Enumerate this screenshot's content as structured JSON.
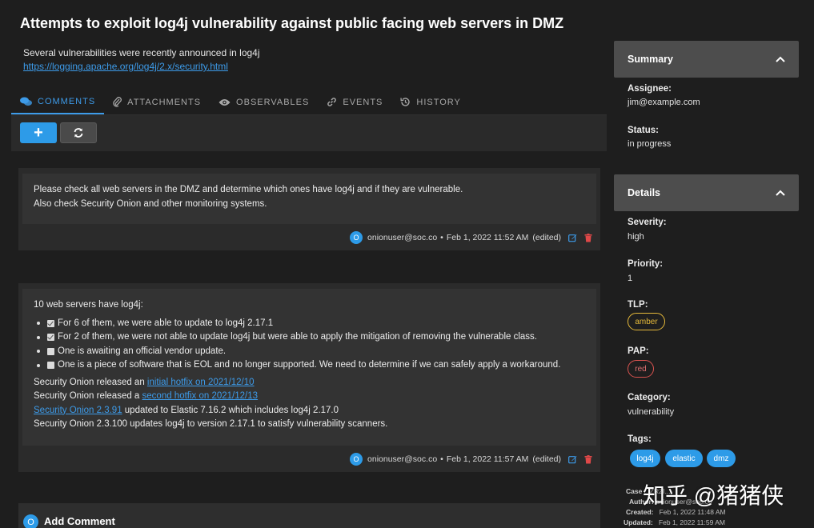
{
  "case": {
    "title": "Attempts to exploit log4j vulnerability against public facing web servers in DMZ",
    "description": "Several vulnerabilities were recently announced in log4j",
    "link": "https://logging.apache.org/log4j/2.x/security.html"
  },
  "tabs": [
    {
      "label": "COMMENTS",
      "icon": "comments-icon",
      "active": true
    },
    {
      "label": "ATTACHMENTS",
      "icon": "paperclip-icon"
    },
    {
      "label": "OBSERVABLES",
      "icon": "eye-icon"
    },
    {
      "label": "EVENTS",
      "icon": "link-icon"
    },
    {
      "label": "HISTORY",
      "icon": "history-icon"
    }
  ],
  "toolbar": {
    "add_label": "+"
  },
  "comments": [
    {
      "line1": "Please check all web servers in the DMZ and determine which ones have log4j and if they are vulnerable.",
      "line2": "Also check Security Onion and other monitoring systems.",
      "avatar": "O",
      "author": "onionuser@soc.co",
      "separator": "•",
      "timestamp": "Feb 1, 2022 11:52 AM",
      "edited": "(edited)"
    },
    {
      "intro": "10 web servers have log4j:",
      "checklist": [
        {
          "text": "For 6 of them, we were able to update to log4j 2.17.1",
          "checked": true
        },
        {
          "text": "For 2 of them, we were not able to update log4j but were able to apply the mitigation of removing the vulnerable class.",
          "checked": true
        },
        {
          "text": "One is awaiting an official vendor update.",
          "checked": false
        },
        {
          "text": "One is a piece of software that is EOL and no longer supported. We need to determine if we can safely apply a workaround.",
          "checked": false
        }
      ],
      "p1_pre": "Security Onion released an ",
      "p1_link": "initial hotfix on 2021/12/10",
      "p2_pre": "Security Onion released a ",
      "p2_link": "second hotfix on 2021/12/13",
      "p3_link": "Security Onion 2.3.91",
      "p3_post": " updated to Elastic 7.16.2 which includes log4j 2.17.0",
      "p4": "Security Onion 2.3.100 updates log4j to version 2.17.1 to satisfy vulnerability scanners.",
      "avatar": "O",
      "author": "onionuser@soc.co",
      "separator": "•",
      "timestamp": "Feb 1, 2022 11:57 AM",
      "edited": "(edited)"
    }
  ],
  "add_comment": {
    "avatar": "O",
    "label": "Add Comment"
  },
  "summary": {
    "heading": "Summary",
    "assignee_label": "Assignee:",
    "assignee": "jim@example.com",
    "status_label": "Status:",
    "status": "in progress"
  },
  "details": {
    "heading": "Details",
    "severity_label": "Severity:",
    "severity": "high",
    "priority_label": "Priority:",
    "priority": "1",
    "tlp_label": "TLP:",
    "tlp": "amber",
    "pap_label": "PAP:",
    "pap": "red",
    "category_label": "Category:",
    "category": "vulnerability",
    "tags_label": "Tags:",
    "tags": [
      "log4j",
      "elastic",
      "dmz"
    ]
  },
  "meta": {
    "case_label": "Case",
    "case_value": "...ZRZI...",
    "author_label": "Author:",
    "author_value": "onionuser@soc.co",
    "created_label": "Created:",
    "created": "Feb 1, 2022 11:48 AM",
    "updated_label": "Updated:",
    "updated": "Feb 1, 2022 11:59 AM"
  },
  "watermark": "知乎 @猪猪侠",
  "colors": {
    "accent": "#2d9be8",
    "amber": "#e5b93a",
    "red": "#d9534f",
    "panel": "#4d4d4d"
  }
}
